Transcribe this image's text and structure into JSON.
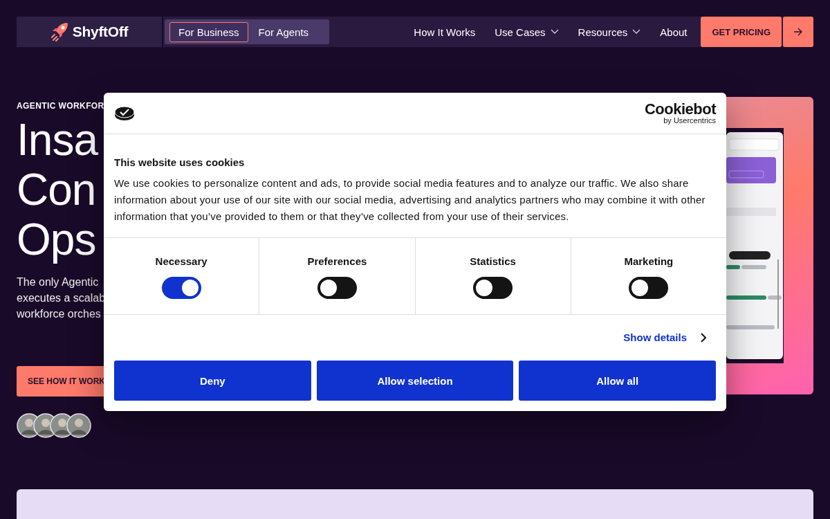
{
  "nav": {
    "brand": "ShyftOff",
    "segments": [
      {
        "label": "For Business",
        "selected": true
      },
      {
        "label": "For Agents",
        "selected": false
      }
    ],
    "links": [
      {
        "label": "How It Works",
        "dropdown": false
      },
      {
        "label": "Use Cases",
        "dropdown": true
      },
      {
        "label": "Resources",
        "dropdown": true
      },
      {
        "label": "About",
        "dropdown": false
      }
    ],
    "cta": "GET PRICING"
  },
  "hero": {
    "eyebrow": "AGENTIC WORKFOR",
    "headline": [
      "Insa",
      "Con",
      "Ops"
    ],
    "body": [
      "The only Agentic",
      "executes a scalab",
      "workforce orches"
    ],
    "button": "SEE HOW IT WORK"
  },
  "cookie_dialog": {
    "brand": "Cookiebot",
    "brand_sub": "by Usercentrics",
    "title": "This website uses cookies",
    "text": "We use cookies to personalize content and ads, to provide social media features and to analyze our traffic. We also share information about your use of our site with our social media, advertising and analytics partners who may combine it with other information that you’ve provided to them or that they’ve collected from your use of their services.",
    "categories": [
      {
        "label": "Necessary",
        "on": true
      },
      {
        "label": "Preferences",
        "on": false
      },
      {
        "label": "Statistics",
        "on": false
      },
      {
        "label": "Marketing",
        "on": false
      }
    ],
    "details_link": "Show details",
    "buttons": [
      "Deny",
      "Allow selection",
      "Allow all"
    ]
  }
}
